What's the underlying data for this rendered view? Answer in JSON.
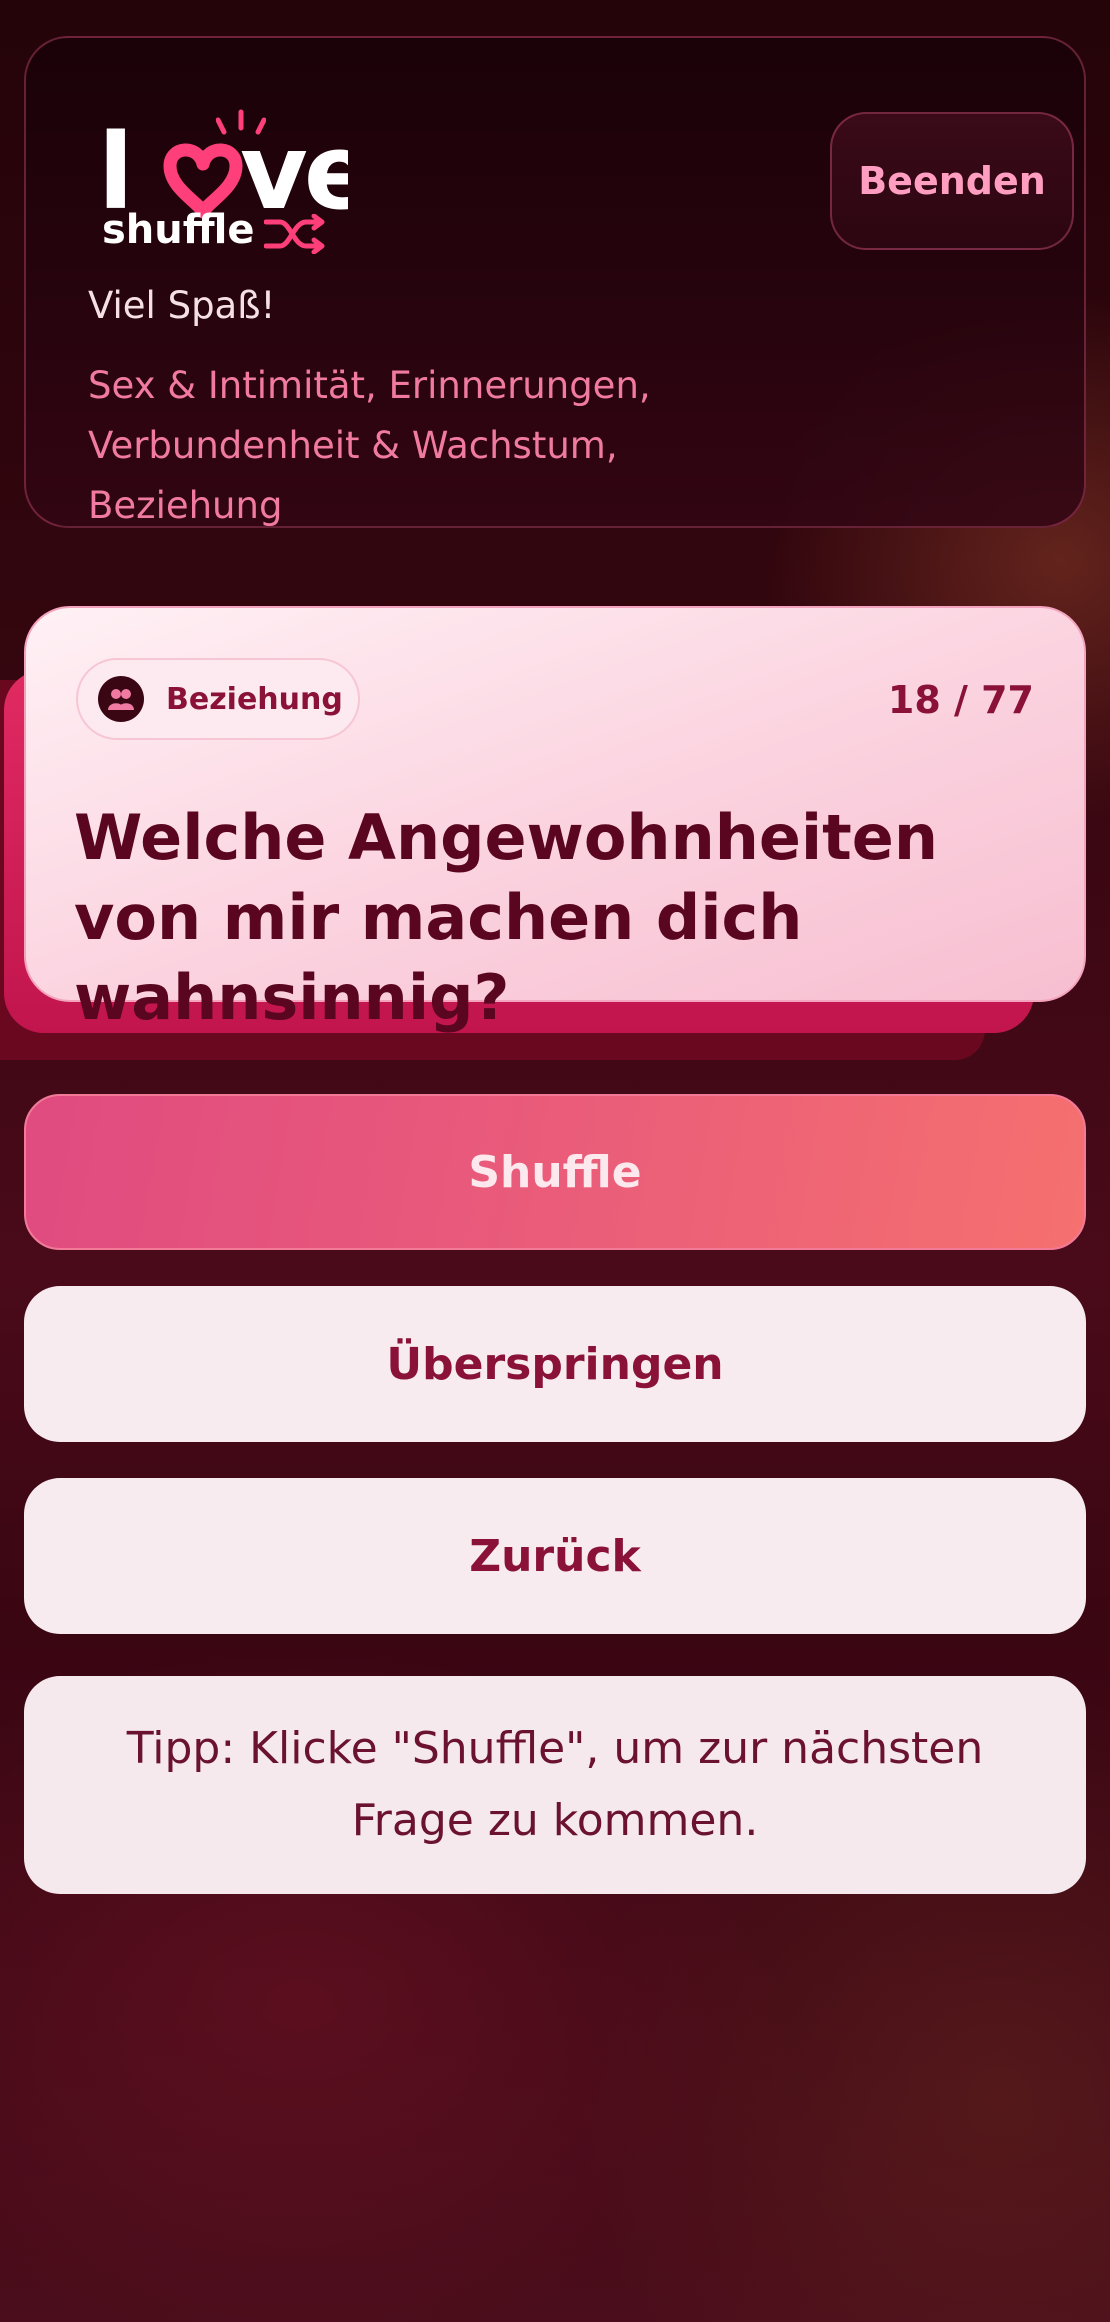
{
  "header": {
    "logo": {
      "word_top": "love",
      "word_bottom": "shuffle"
    },
    "end_button_label": "Beenden",
    "greeting": "Viel Spaß!",
    "categories_text": "Sex & Intimität, Erinnerungen, Verbundenheit & Wachstum, Beziehung"
  },
  "question_card": {
    "category_label": "Beziehung",
    "counter": "18 / 77",
    "question": "Welche Angewohnheiten von mir machen dich wahnsinnig?"
  },
  "actions": {
    "shuffle_label": "Shuffle",
    "skip_label": "Überspringen",
    "back_label": "Zurück"
  },
  "tip": "Tipp: Klicke \"Shuffle\", um zur nächsten Frage zu kommen.",
  "colors": {
    "accent_pink": "#f07aa2",
    "brand_pink": "#ff3f7a",
    "card_text": "#5a0620",
    "button_text": "#8a1238"
  }
}
